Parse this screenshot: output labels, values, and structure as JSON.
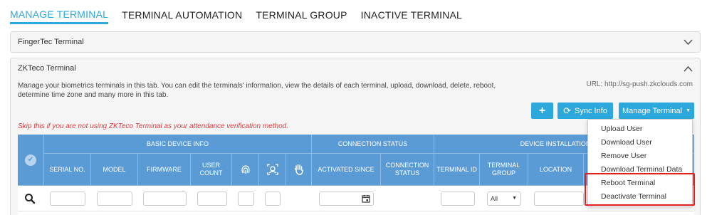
{
  "tabs": [
    "MANAGE TERMINAL",
    "TERMINAL AUTOMATION",
    "TERMINAL GROUP",
    "INACTIVE TERMINAL"
  ],
  "panels": {
    "fingertec": {
      "title": "FingerTec Terminal"
    },
    "zkteco": {
      "title": "ZKTeco Terminal",
      "description": "Manage your biometrics terminals in this tab. You can edit the terminals' information, view the details of each terminal, upload, download, delete, reboot, determine time zone and many more in this tab.",
      "url": "URL: http://sg-push.zkclouds.com",
      "warning": "Skip this if you are not using ZKTeco Terminal as your attendance verification method."
    }
  },
  "buttons": {
    "add": "+",
    "sync": "Sync Info",
    "manage": "Manage Terminal"
  },
  "table": {
    "groups": {
      "basic": "BASIC DEVICE INFO",
      "connection": "CONNECTION STATUS",
      "installation": "DEVICE INSTALLATION INFO"
    },
    "columns": {
      "serial": "SERIAL NO.",
      "model": "MODEL",
      "firmware": "FIRMWARE",
      "user_count": "USER COUNT",
      "activated_since": "ACTIVATED SINCE",
      "connection_status": "CONNECTION STATUS",
      "terminal_id": "TERMINAL ID",
      "terminal_group": "TERMINAL GROUP",
      "location": "LOCATION"
    },
    "group_filter": "All"
  },
  "menu": [
    "Upload User",
    "Download User",
    "Remove User",
    "Download Terminal Data",
    "Reboot Terminal",
    "Deactivate Terminal"
  ],
  "colors": {
    "accent": "#2da8dc",
    "header": "#5b9bd5",
    "highlight": "#e02020",
    "warning": "#e0393e"
  }
}
